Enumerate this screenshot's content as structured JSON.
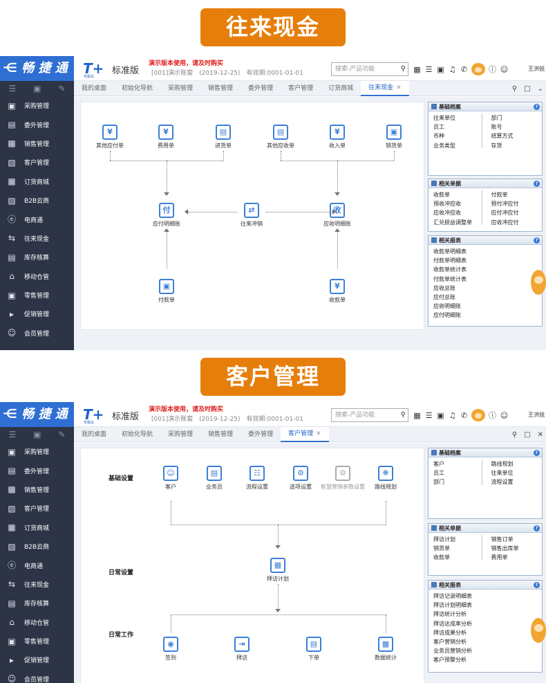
{
  "sections": [
    {
      "banner": "往来现金",
      "app": {
        "logo": "⋲ 畅 捷 通",
        "tplus_logo": "T+",
        "tplus_sub": "专属云",
        "edition": "标准版",
        "demo_notice": "演示版本使用，请及时购买",
        "account": "[001]演示账套　(2019-12-25)　有效期:0001-01-01",
        "search_placeholder": "搜索-产品功能",
        "user": "王洪锐",
        "sidebar": [
          "采购管理",
          "委外管理",
          "销售管理",
          "客户管理",
          "订货商城",
          "B2B云商",
          "电商通",
          "往来现金",
          "库存核算",
          "移动仓管",
          "零售管理",
          "促销管理",
          "会员管理"
        ],
        "tabs": [
          "我的桌面",
          "初始化导航",
          "采购管理",
          "销售管理",
          "委外管理",
          "客户管理",
          "订货商城",
          "往来现金"
        ],
        "active_tab": "往来现金",
        "flow": {
          "top_left": [
            "其他应付单",
            "费用单",
            "进货单"
          ],
          "top_right": [
            "其他应收单",
            "收入单",
            "销货单"
          ],
          "mid": [
            "应付明细账",
            "往来冲销",
            "应收明细账"
          ],
          "bottom": [
            "付款单",
            "收款单"
          ]
        },
        "panels": [
          {
            "title": "基础档案",
            "col1": [
              "往来单位",
              "员工",
              "币种",
              "业务类型"
            ],
            "col2": [
              "部门",
              "账号",
              "结算方式",
              "存货"
            ]
          },
          {
            "title": "相关单据",
            "col1": [
              "收款单",
              "预收冲应收",
              "应收冲应收",
              "汇兑损益调整单"
            ],
            "col2": [
              "付款单",
              "预付冲应付",
              "应付冲应付",
              "应收冲应付"
            ]
          },
          {
            "title": "相关报表",
            "col1": [
              "收款单明细表",
              "付款单明细表",
              "收款单统计表",
              "付款单统计表",
              "应收总账",
              "应付总账",
              "应收明细账",
              "应付明细账"
            ],
            "col2": []
          }
        ]
      }
    },
    {
      "banner": "客户管理",
      "app": {
        "logo": "⋲ 畅 捷 通",
        "tplus_logo": "T+",
        "tplus_sub": "专属云",
        "edition": "标准版",
        "demo_notice": "演示版本使用，请及时购买",
        "account": "[001]演示账套　(2019-12-25)　有效期:0001-01-01",
        "search_placeholder": "搜索-产品功能",
        "user": "王洪锐",
        "sidebar": [
          "采购管理",
          "委外管理",
          "销售管理",
          "客户管理",
          "订货商城",
          "B2B云商",
          "电商通",
          "往来现金",
          "库存核算",
          "移动仓管",
          "零售管理",
          "促销管理",
          "会员管理"
        ],
        "tabs": [
          "我的桌面",
          "初始化导航",
          "采购管理",
          "销售管理",
          "委外管理",
          "客户管理"
        ],
        "active_tab": "客户管理",
        "rows": {
          "row1_label": "基础设置",
          "row1": [
            "客户",
            "业务员",
            "流程设置",
            "选项设置",
            "智慧营销参数设置",
            "路线规划"
          ],
          "row2_label": "日常设置",
          "row2": [
            "拜访计划"
          ],
          "row3_label": "日常工作",
          "row3": [
            "签到",
            "拜访",
            "下单",
            "数据统计"
          ]
        },
        "panels": [
          {
            "title": "基础档案",
            "col1": [
              "客户",
              "员工",
              "部门"
            ],
            "col2": [
              "路线规划",
              "往来单位",
              "流程设置"
            ]
          },
          {
            "title": "相关单据",
            "col1": [
              "拜访计划",
              "销货单",
              "收款单"
            ],
            "col2": [
              "销售订单",
              "销售出库单",
              "费用单"
            ]
          },
          {
            "title": "相关报表",
            "col1": [
              "拜访记录明细表",
              "拜访计划明细表",
              "拜访统计分析",
              "拜访达成率分析",
              "拜访成果分析",
              "客户营销分析",
              "业务员营销分析",
              "客户预警分析"
            ],
            "col2": []
          }
        ]
      }
    }
  ],
  "icons": {
    "sidebar_tools": [
      "menu-icon",
      "grid-icon",
      "export-icon"
    ],
    "top": [
      "calculator-icon",
      "task-icon",
      "message-icon",
      "bell-icon",
      "phone-icon",
      "mascot-icon",
      "help-icon",
      "user-icon"
    ]
  }
}
